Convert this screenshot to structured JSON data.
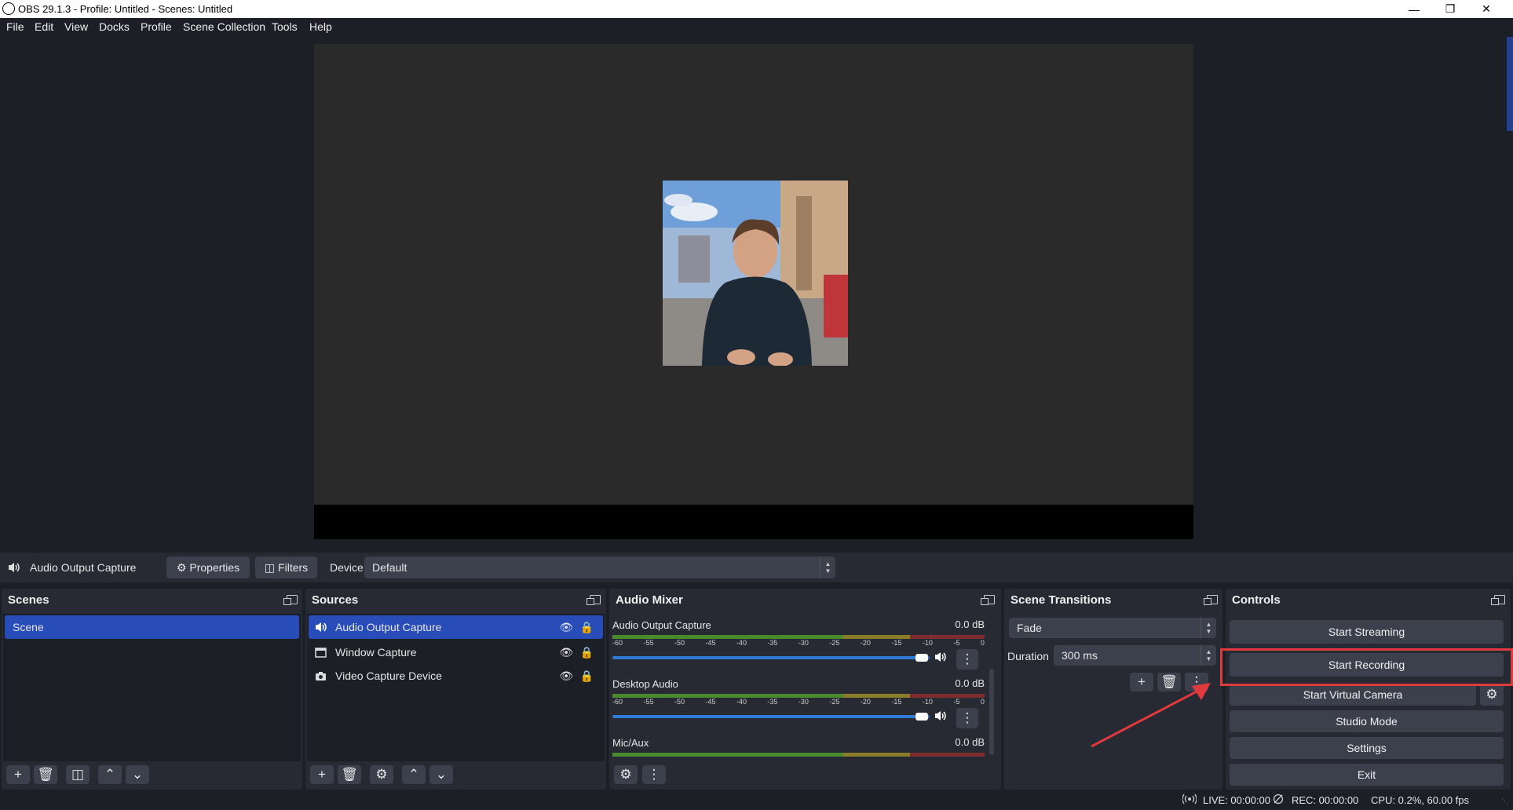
{
  "window": {
    "title": "OBS 29.1.3 - Profile: Untitled - Scenes: Untitled",
    "controls": [
      "minimize-icon",
      "maximize-icon",
      "close-icon"
    ]
  },
  "menu": [
    "File",
    "Edit",
    "View",
    "Docks",
    "Profile",
    "Scene Collection",
    "Tools",
    "Help"
  ],
  "source_toolbar": {
    "source_name": "Audio Output Capture",
    "properties_label": "Properties",
    "filters_label": "Filters",
    "device_label": "Device",
    "device_value": "Default"
  },
  "scenes": {
    "title": "Scenes",
    "items": [
      "Scene"
    ],
    "selected": 0
  },
  "sources": {
    "title": "Sources",
    "items": [
      {
        "name": "Audio Output Capture",
        "icon": "speaker-icon"
      },
      {
        "name": "Window Capture",
        "icon": "window-icon"
      },
      {
        "name": "Video Capture Device",
        "icon": "camera-icon"
      }
    ],
    "selected": 0
  },
  "audio_mixer": {
    "title": "Audio Mixer",
    "ticks": [
      "-60",
      "-55",
      "-50",
      "-45",
      "-40",
      "-35",
      "-30",
      "-25",
      "-20",
      "-15",
      "-10",
      "-5",
      "0"
    ],
    "channels": [
      {
        "name": "Audio Output Capture",
        "level": "0.0 dB",
        "volume_fraction": 1.0
      },
      {
        "name": "Desktop Audio",
        "level": "0.0 dB",
        "volume_fraction": 1.0
      },
      {
        "name": "Mic/Aux",
        "level": "0.0 dB"
      }
    ]
  },
  "scene_transitions": {
    "title": "Scene Transitions",
    "transition": "Fade",
    "duration_label": "Duration",
    "duration_value": "300 ms"
  },
  "controls": {
    "title": "Controls",
    "start_streaming": "Start Streaming",
    "start_recording": "Start Recording",
    "start_virtual_camera": "Start Virtual Camera",
    "studio_mode": "Studio Mode",
    "settings": "Settings",
    "exit": "Exit"
  },
  "status": {
    "live": "LIVE: 00:00:00",
    "rec": "REC: 00:00:00",
    "cpu": "CPU: 0.2%, 60.00 fps"
  },
  "colors": {
    "selection": "#284cb8",
    "highlight_box": "#e0393e",
    "panel": "#272a33",
    "background": "#1d1f26"
  }
}
